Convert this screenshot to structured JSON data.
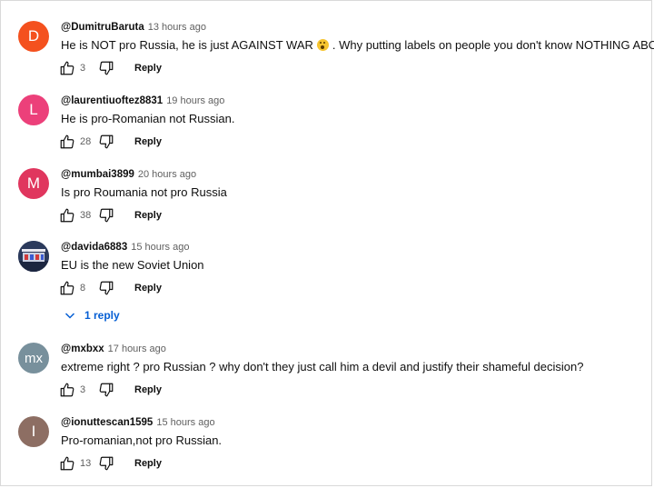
{
  "comments": [
    {
      "author": "@DumitruBaruta",
      "time": "13 hours ago",
      "text_before": "He is NOT pro Russia, he is just AGAINST WAR",
      "emoji": "astonished-face",
      "text_after": ". Why putting labels on people you don't know NOTHING ABOUT?",
      "likes": "3",
      "reply_label": "Reply",
      "avatar": {
        "letter": "D",
        "color": "#f4511e"
      }
    },
    {
      "author": "@laurentiuoftez8831",
      "time": "19 hours ago",
      "text": "He is pro-Romanian not Russian.",
      "likes": "28",
      "reply_label": "Reply",
      "avatar": {
        "letter": "L",
        "color": "#ec407a"
      }
    },
    {
      "author": "@mumbai3899",
      "time": "20 hours ago",
      "text": "Is pro Roumania not pro Russia",
      "likes": "38",
      "reply_label": "Reply",
      "avatar": {
        "letter": "M",
        "color": "#e0365e"
      }
    },
    {
      "author": "@davida6883",
      "time": "15 hours ago",
      "text": "EU is the new Soviet Union",
      "likes": "8",
      "reply_label": "Reply",
      "avatar": {
        "letter": "",
        "color": "#2b3a5c"
      },
      "replies_label": "1 reply"
    },
    {
      "author": "@mxbxx",
      "time": "17 hours ago",
      "text": "extreme right ? pro Russian ? why don't they just call him a devil and justify their shameful decision?",
      "likes": "3",
      "reply_label": "Reply",
      "avatar": {
        "letter": "mx",
        "color": "#78909c"
      }
    },
    {
      "author": "@ionuttescan1595",
      "time": "15 hours ago",
      "text": "Pro-romanian,not pro Russian.",
      "likes": "13",
      "reply_label": "Reply",
      "avatar": {
        "letter": "I",
        "color": "#8d6e63"
      }
    }
  ]
}
